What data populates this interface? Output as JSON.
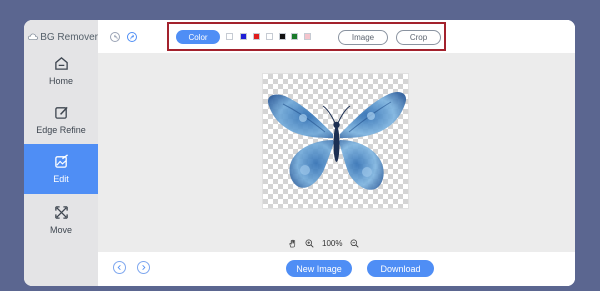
{
  "app": {
    "title": "BG Remover"
  },
  "sidebar": {
    "items": [
      {
        "label": "Home",
        "icon": "home-icon"
      },
      {
        "label": "Edge Refine",
        "icon": "edit-icon"
      },
      {
        "label": "Edit",
        "icon": "image-edit-icon",
        "active": true
      },
      {
        "label": "Move",
        "icon": "move-icon"
      }
    ]
  },
  "toolbar": {
    "color_label": "Color",
    "image_label": "Image",
    "crop_label": "Crop",
    "swatches": [
      "#ffffff",
      "#1f1fd6",
      "#e01c1c",
      "#ffffff",
      "#111111",
      "#1a7a2a",
      "#f4c4cc"
    ]
  },
  "zoom": {
    "level": "100%"
  },
  "bottom": {
    "new_image_label": "New Image",
    "download_label": "Download"
  },
  "colors": {
    "accent": "#4f8ef5",
    "highlight_border": "#a3222d",
    "background": "#5b6690"
  }
}
